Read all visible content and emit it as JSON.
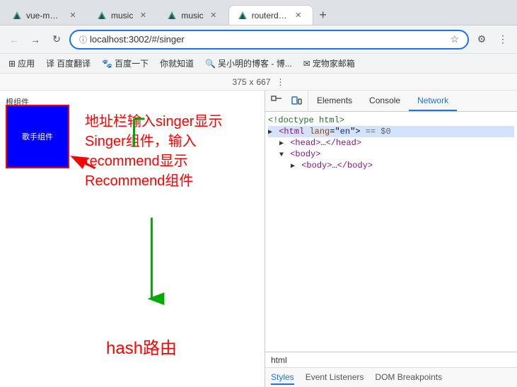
{
  "tabs": [
    {
      "label": "vue-music",
      "active": false,
      "id": "tab-vue-music"
    },
    {
      "label": "music",
      "active": false,
      "id": "tab-music-1"
    },
    {
      "label": "music",
      "active": false,
      "id": "tab-music-2"
    },
    {
      "label": "routerdemo",
      "active": true,
      "id": "tab-routerdemo"
    }
  ],
  "tab_new_label": "+",
  "address_bar": {
    "url": "localhost:3002/#/singer",
    "lock_icon": "🔒"
  },
  "nav": {
    "back": "←",
    "forward": "→",
    "reload": "↻"
  },
  "bookmarks": [
    {
      "label": "应用",
      "icon": "⊞"
    },
    {
      "label": "百度翻译",
      "icon": "译"
    },
    {
      "label": "百度一下",
      "icon": "🐾"
    },
    {
      "label": "你就知道",
      "icon": ""
    },
    {
      "label": "吴小明的博客 - 博...",
      "icon": "🔍"
    },
    {
      "label": "宠物家邮箱",
      "icon": "✉"
    }
  ],
  "dimensions": {
    "width": "375",
    "x": "x",
    "height": "667"
  },
  "viewport": {
    "root_label": "根组件",
    "singer_label": "歌手组件"
  },
  "annotation": {
    "text": "地址栏输入singer显示Singer组件，输入recommend显示Recommend组件",
    "hash_label": "hash路由"
  },
  "devtools": {
    "icons": [
      "☰",
      "🔍"
    ],
    "tabs": [
      "Elements",
      "Console",
      "Network"
    ],
    "html_lines": [
      {
        "text": "<!doctype html>",
        "type": "comment",
        "indent": 0
      },
      {
        "text": "<html lang=\"en\"> == $0",
        "type": "tag",
        "indent": 0,
        "selected": true,
        "triangle": true
      },
      {
        "text": "▶ <head>…</head>",
        "type": "tag",
        "indent": 1,
        "collapsed": true
      },
      {
        "text": "▼ <body>",
        "type": "tag",
        "indent": 1,
        "expanded": true
      },
      {
        "text": "▶ <body>…</body>",
        "type": "tag",
        "indent": 2,
        "collapsed": true
      }
    ],
    "footer": "html",
    "bottom_tabs": [
      "Styles",
      "Event Listeners",
      "DOM Breakpoints"
    ]
  }
}
